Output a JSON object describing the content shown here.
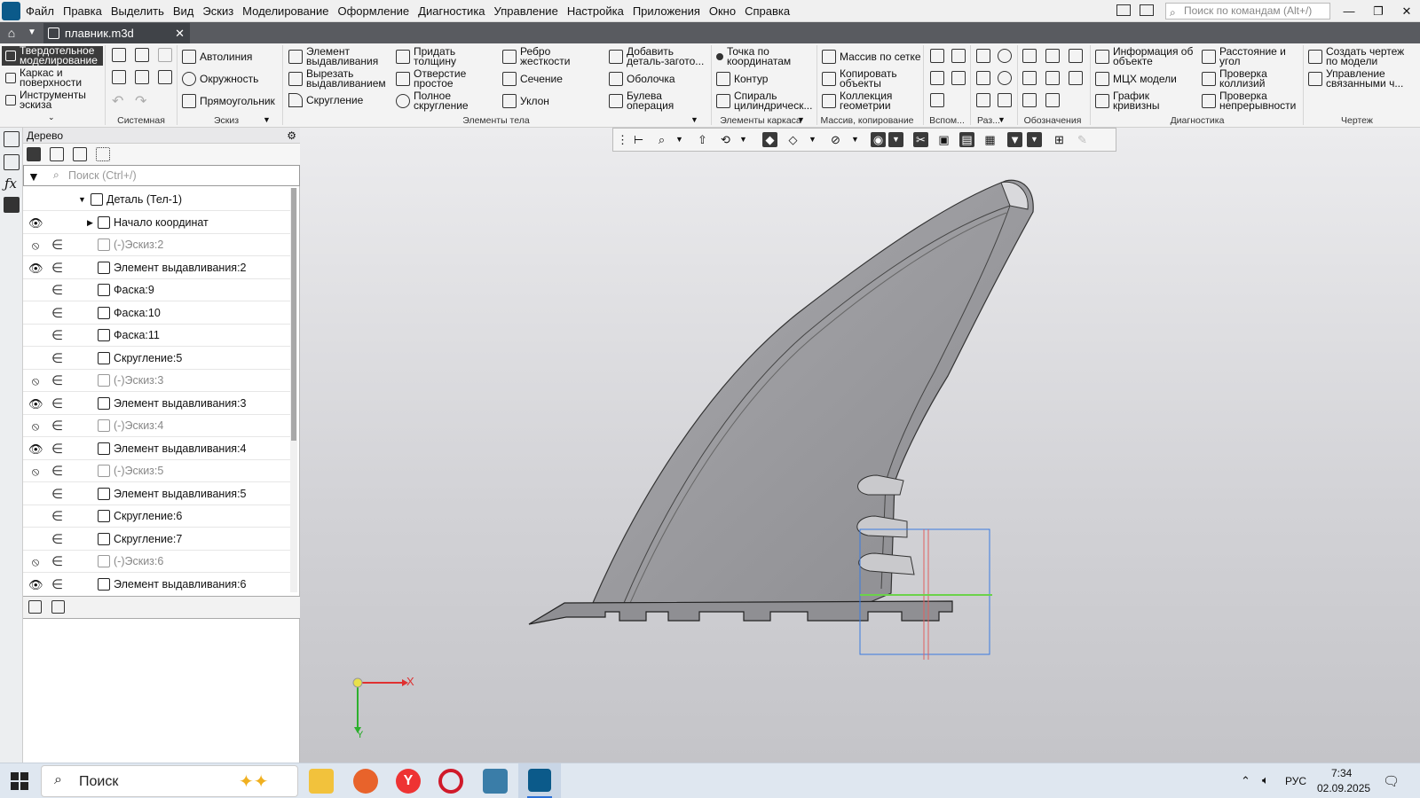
{
  "menubar": {
    "items": [
      "Файл",
      "Правка",
      "Выделить",
      "Вид",
      "Эскиз",
      "Моделирование",
      "Оформление",
      "Диагностика",
      "Управление",
      "Настройка",
      "Приложения",
      "Окно",
      "Справка"
    ],
    "search_placeholder": "Поиск по командам (Alt+/)"
  },
  "tabs": {
    "doc_title": "плавник.m3d"
  },
  "ribbon": {
    "modes": [
      "Твердотельное моделирование",
      "Каркас и поверхности",
      "Инструменты эскиза"
    ],
    "sketch_tools": [
      "Автолиния",
      "Окружность",
      "Прямоугольник"
    ],
    "body_tools": [
      "Элемент выдавливания",
      "Вырезать выдавливанием",
      "Скругление",
      "Придать толщину",
      "Отверстие простое",
      "Полное скругление",
      "Ребро жесткости",
      "Сечение",
      "Уклон",
      "Добавить деталь-загото...",
      "Оболочка",
      "Булева операция"
    ],
    "frame_tools": [
      "Точка по координатам",
      "Контур",
      "Спираль цилиндрическ..."
    ],
    "array_tools": [
      "Массив по сетке",
      "Копировать объекты",
      "Коллекция геометрии"
    ],
    "diag_tools": [
      "Информация об объекте",
      "МЦХ модели",
      "График кривизны",
      "Расстояние и угол",
      "Проверка коллизий",
      "Проверка непрерывности"
    ],
    "drawing_tools": [
      "Создать чертеж по модели",
      "Управление связанными ч..."
    ],
    "groups": [
      "Системная",
      "Эскиз",
      "Элементы тела",
      "Элементы каркаса",
      "Массив, копирование",
      "Вспом...",
      "Раз...",
      "Обозначения",
      "Диагностика",
      "Чертеж"
    ]
  },
  "tree": {
    "title": "Дерево",
    "search_placeholder": "Поиск (Ctrl+/)",
    "rows": [
      {
        "label": "Деталь (Тел-1)",
        "eye": "",
        "inc": false,
        "dim": false,
        "level": 0
      },
      {
        "label": "Начало координат",
        "eye": "visible",
        "inc": false,
        "dim": false,
        "level": 1
      },
      {
        "label": "(-)Эскиз:2",
        "eye": "hidden",
        "inc": true,
        "dim": true,
        "level": 1
      },
      {
        "label": "Элемент выдавливания:2",
        "eye": "visible",
        "inc": true,
        "dim": false,
        "level": 1
      },
      {
        "label": "Фаска:9",
        "eye": "",
        "inc": true,
        "dim": false,
        "level": 1
      },
      {
        "label": "Фаска:10",
        "eye": "",
        "inc": true,
        "dim": false,
        "level": 1
      },
      {
        "label": "Фаска:11",
        "eye": "",
        "inc": true,
        "dim": false,
        "level": 1
      },
      {
        "label": "Скругление:5",
        "eye": "",
        "inc": true,
        "dim": false,
        "level": 1
      },
      {
        "label": "(-)Эскиз:3",
        "eye": "hidden",
        "inc": true,
        "dim": true,
        "level": 1
      },
      {
        "label": "Элемент выдавливания:3",
        "eye": "visible",
        "inc": true,
        "dim": false,
        "level": 1
      },
      {
        "label": "(-)Эскиз:4",
        "eye": "hidden",
        "inc": true,
        "dim": true,
        "level": 1
      },
      {
        "label": "Элемент выдавливания:4",
        "eye": "visible",
        "inc": true,
        "dim": false,
        "level": 1
      },
      {
        "label": "(-)Эскиз:5",
        "eye": "hidden",
        "inc": true,
        "dim": true,
        "level": 1
      },
      {
        "label": "Элемент выдавливания:5",
        "eye": "",
        "inc": true,
        "dim": false,
        "level": 1
      },
      {
        "label": "Скругление:6",
        "eye": "",
        "inc": true,
        "dim": false,
        "level": 1
      },
      {
        "label": "Скругление:7",
        "eye": "",
        "inc": true,
        "dim": false,
        "level": 1
      },
      {
        "label": "(-)Эскиз:6",
        "eye": "hidden",
        "inc": true,
        "dim": true,
        "level": 1
      },
      {
        "label": "Элемент выдавливания:6",
        "eye": "visible",
        "inc": true,
        "dim": false,
        "level": 1
      }
    ]
  },
  "viewport": {
    "axis_x": "X",
    "axis_y": "Y"
  },
  "taskbar": {
    "search_label": "Поиск",
    "lang": "РУС",
    "time": "7:34",
    "date": "02.09.2025"
  }
}
